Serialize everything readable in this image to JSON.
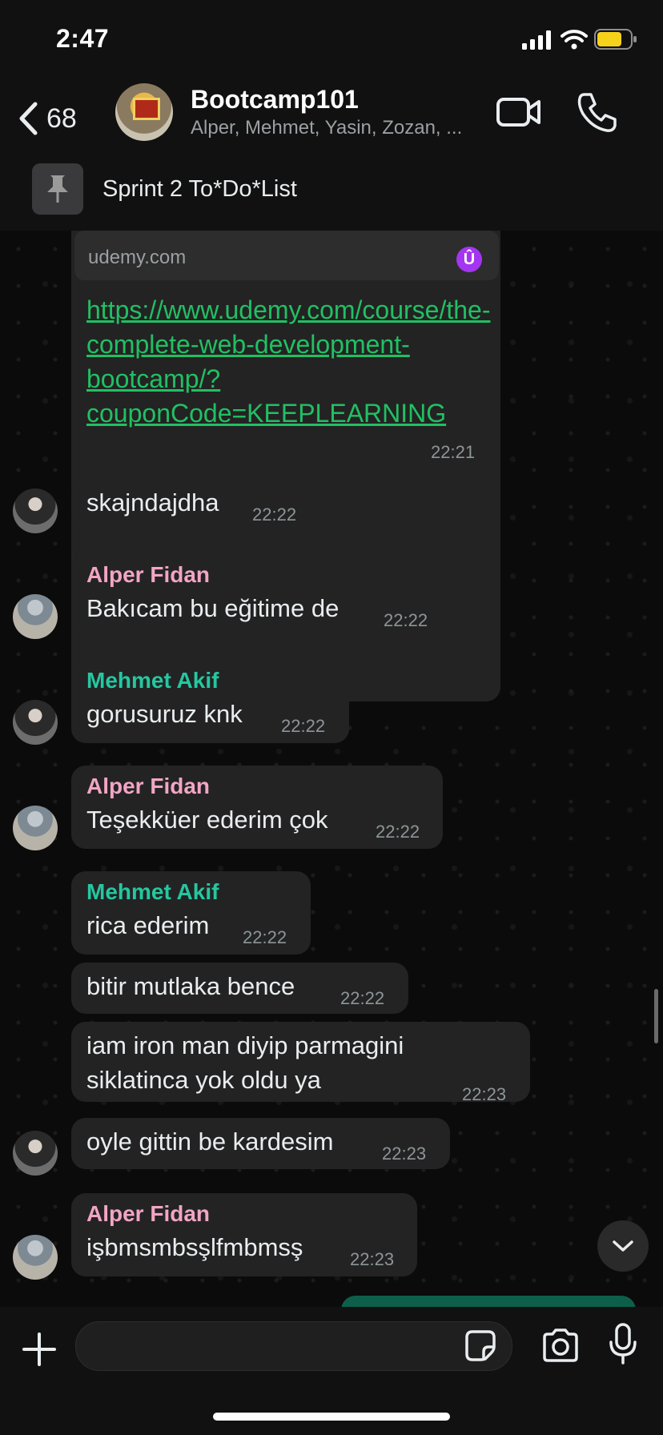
{
  "status": {
    "time": "2:47"
  },
  "header": {
    "back_count": "68",
    "title": "Bootcamp101",
    "members": "Alper, Mehmet, Yasin, Zozan, ..."
  },
  "pinned": {
    "text": "Sprint 2 To*Do*List"
  },
  "messages": {
    "link": {
      "domain": "udemy.com",
      "badge": "Û",
      "url": "https://www.udemy.com/course/the-complete-web-development-bootcamp/?couponCode=KEEPLEARNING",
      "time": "22:21"
    },
    "m1": {
      "text": "skajndajdha",
      "time": "22:22"
    },
    "m2": {
      "sender": "Alper Fidan",
      "text": "Bakıcam bu eğitime de",
      "time": "22:22"
    },
    "m3": {
      "sender": "Mehmet Akif",
      "text": "gorusuruz knk",
      "time": "22:22"
    },
    "m4": {
      "sender": "Alper Fidan",
      "text": "Teşekküer ederim çok",
      "time": "22:22"
    },
    "m5": {
      "sender": "Mehmet Akif",
      "text": "rica ederim",
      "time": "22:22"
    },
    "m6": {
      "text": "bitir mutlaka bence",
      "time": "22:22"
    },
    "m7": {
      "line1": "iam iron man diyip parmagini",
      "line2": "siklatinca yok oldu ya",
      "time": "22:23"
    },
    "m8": {
      "text": "oyle gittin be kardesim",
      "time": "22:23"
    },
    "m9": {
      "sender": "Alper Fidan",
      "text": "işbmsmbsşlfmbmsş",
      "time": "22:23"
    }
  },
  "colors": {
    "accent_link": "#21c063",
    "sender_alper": "#f2a5c4",
    "sender_mehmet": "#25c7a0",
    "bubble": "#232323",
    "outgoing": "#0d5f4a"
  },
  "icons": [
    "chevron-left-icon",
    "video-icon",
    "phone-icon",
    "pin-icon",
    "udemy-icon",
    "chevron-down-icon",
    "plus-icon",
    "sticker-icon",
    "camera-icon",
    "microphone-icon",
    "signal-icon",
    "wifi-icon",
    "battery-icon"
  ]
}
